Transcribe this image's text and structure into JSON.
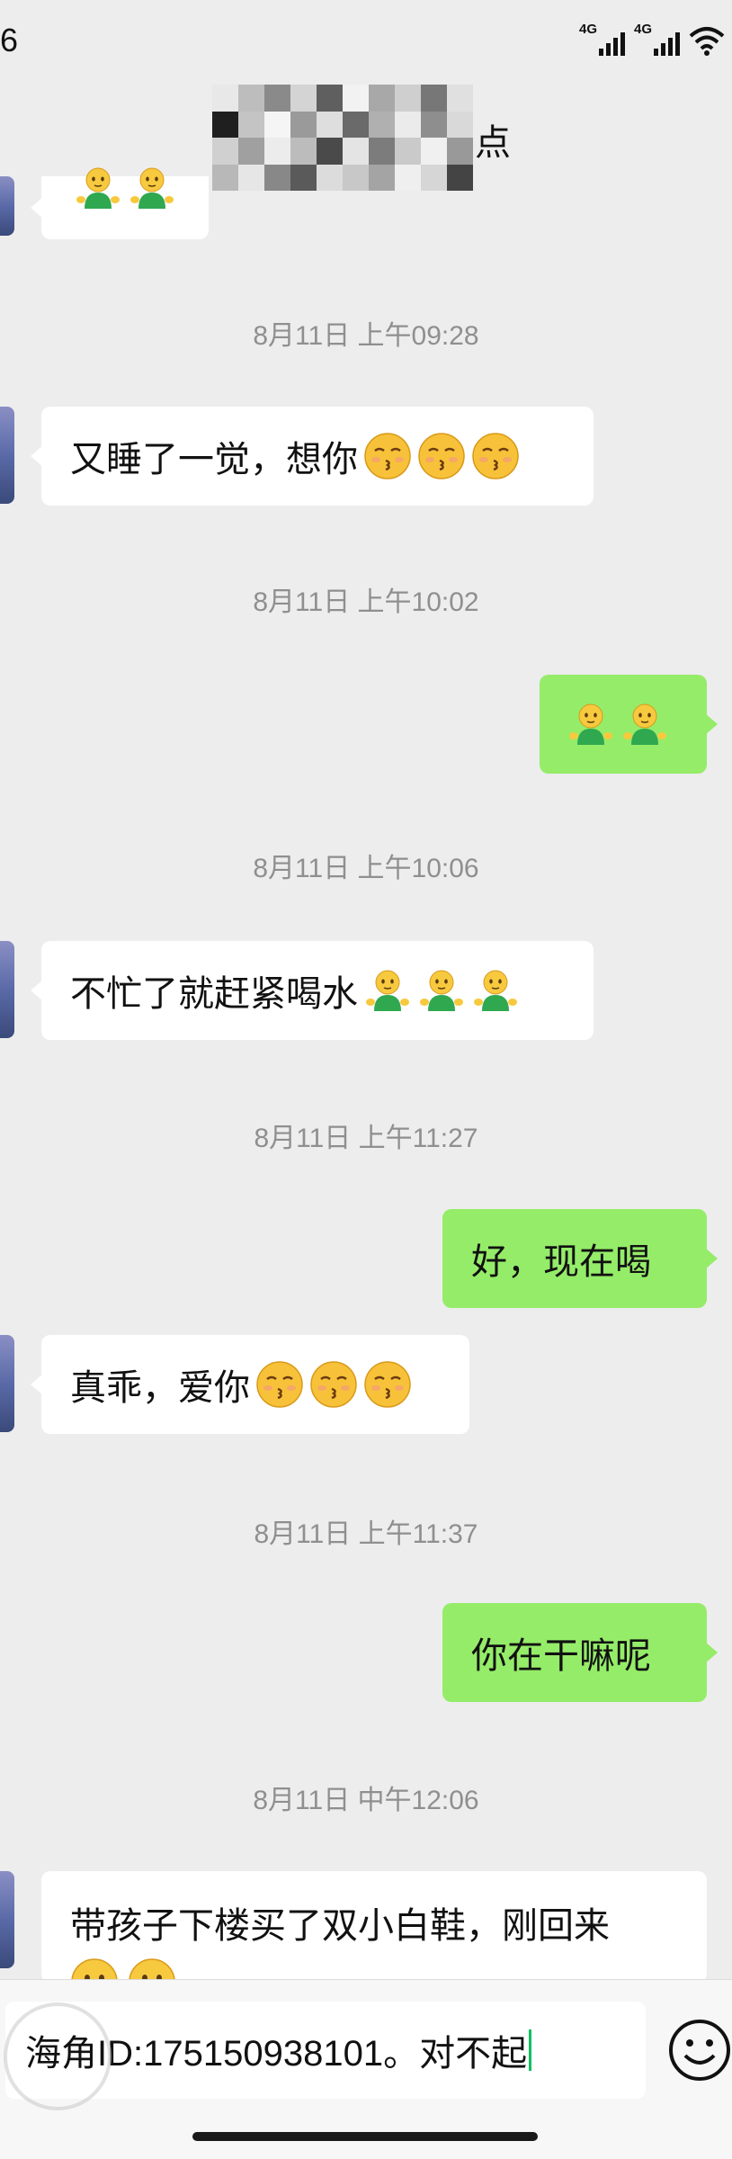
{
  "status_bar": {
    "time_partial": "6",
    "network_1": "4G",
    "network_2": "4G"
  },
  "header": {
    "contact_name_suffix": "点"
  },
  "messages": [
    {
      "type": "timestamp",
      "text": "8月11日 上午09:28"
    },
    {
      "type": "incoming",
      "text": "又睡了一觉，想你",
      "emoji": "kissing-face-icon",
      "emoji_count": 3
    },
    {
      "type": "timestamp",
      "text": "8月11日 上午10:02"
    },
    {
      "type": "outgoing",
      "text": "",
      "emoji": "green-figure-icon",
      "emoji_count": 2
    },
    {
      "type": "timestamp",
      "text": "8月11日 上午10:06"
    },
    {
      "type": "incoming",
      "text": "不忙了就赶紧喝水",
      "emoji": "green-figure-icon",
      "emoji_count": 3
    },
    {
      "type": "timestamp",
      "text": "8月11日 上午11:27"
    },
    {
      "type": "outgoing",
      "text": "好，现在喝"
    },
    {
      "type": "incoming",
      "text": "真乖，爱你",
      "emoji": "kissing-face-icon",
      "emoji_count": 3
    },
    {
      "type": "timestamp",
      "text": "8月11日 上午11:37"
    },
    {
      "type": "outgoing",
      "text": "你在干嘛呢"
    },
    {
      "type": "timestamp",
      "text": "8月11日 中午12:06"
    },
    {
      "type": "incoming",
      "text": "带孩子下楼买了双小白鞋，刚回来",
      "emoji": "smiling-face-icon",
      "emoji_count": 2
    }
  ],
  "input": {
    "value": "海角ID:175150938101。对不起"
  },
  "colors": {
    "background": "#ededed",
    "outgoing_bubble": "#95ec69",
    "incoming_bubble": "#ffffff",
    "timestamp_text": "#8f8f8f",
    "caret": "#07c160"
  }
}
